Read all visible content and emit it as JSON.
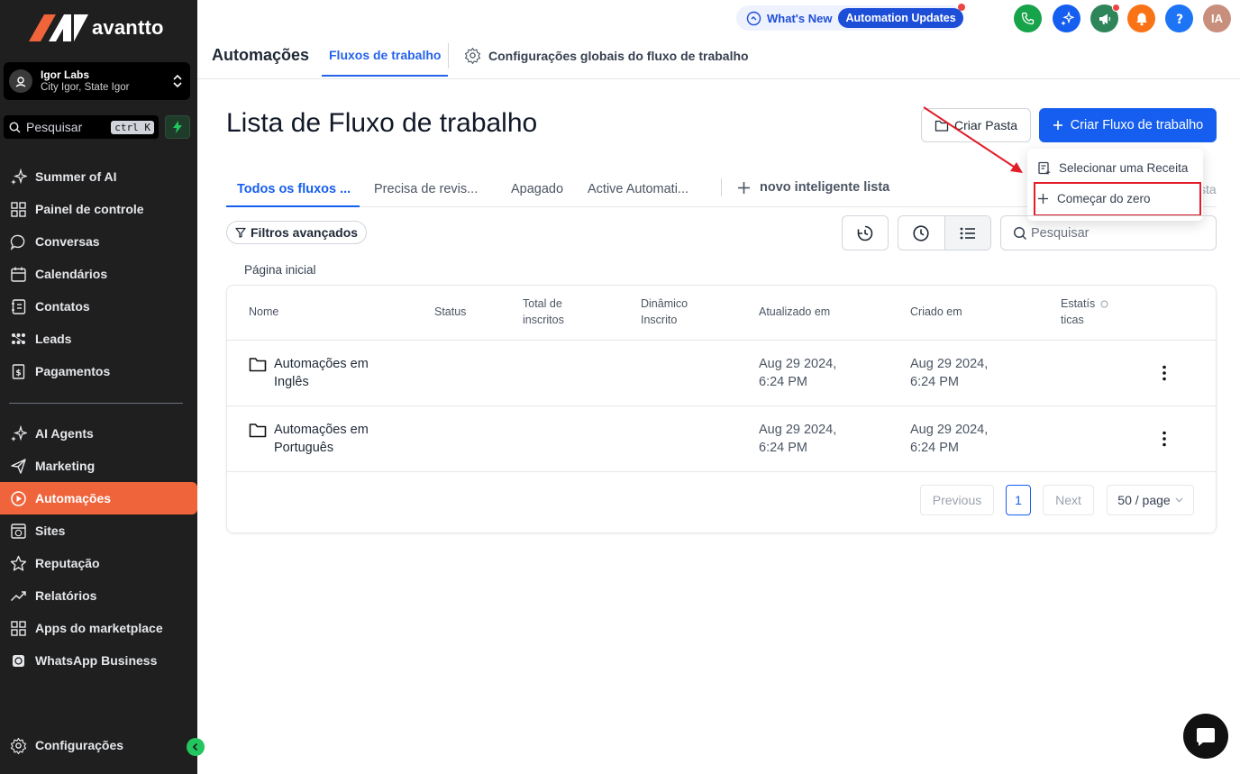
{
  "brand": {
    "name": "avantto"
  },
  "account": {
    "name": "Igor Labs",
    "location": "City Igor, State Igor"
  },
  "sidebar": {
    "search_placeholder": "Pesquisar",
    "search_shortcut": "ctrl K",
    "items": [
      {
        "label": "Summer of AI",
        "icon": "sparkles-icon"
      },
      {
        "label": "Painel de controle",
        "icon": "dashboard-icon"
      },
      {
        "label": "Conversas",
        "icon": "chat-icon"
      },
      {
        "label": "Calendários",
        "icon": "calendar-icon"
      },
      {
        "label": "Contatos",
        "icon": "contacts-icon"
      },
      {
        "label": "Leads",
        "icon": "leads-icon"
      },
      {
        "label": "Pagamentos",
        "icon": "payments-icon"
      },
      {
        "label": "AI Agents",
        "icon": "sparkles-icon"
      },
      {
        "label": "Marketing",
        "icon": "send-icon"
      },
      {
        "label": "Automações",
        "icon": "automation-icon",
        "active": true
      },
      {
        "label": "Sites",
        "icon": "globe-icon"
      },
      {
        "label": "Reputação",
        "icon": "star-icon"
      },
      {
        "label": "Relatórios",
        "icon": "trend-icon"
      },
      {
        "label": "Apps do marketplace",
        "icon": "apps-icon"
      },
      {
        "label": "WhatsApp Business",
        "icon": "whatsapp-icon"
      }
    ],
    "settings_label": "Configurações"
  },
  "header": {
    "whats_new": "What's New",
    "automation_updates": "Automation Updates",
    "avatar_initials": "IA"
  },
  "topnav": {
    "title": "Automações",
    "active_tab": "Fluxos de trabalho",
    "settings_tab": "Configurações globais do fluxo de trabalho"
  },
  "main": {
    "title": "Lista de Fluxo de trabalho",
    "create_folder": "Criar Pasta",
    "create_workflow": "Criar Fluxo de trabalho",
    "dropdown": {
      "recipe": "Selecionar uma Receita",
      "scratch": "Começar do zero"
    },
    "tabs": [
      "Todos os fluxos ...",
      "Precisa de revis...",
      "Apagado",
      "Active Automati..."
    ],
    "new_smart_list": "novo inteligente lista",
    "hidden_tab_text": "sta",
    "filters": "Filtros avançados",
    "search_placeholder": "Pesquisar",
    "breadcrumb": "Página inicial"
  },
  "table": {
    "headers": {
      "name": "Nome",
      "status": "Status",
      "enrolled_1": "Total de",
      "enrolled_2": "inscritos",
      "dynamic_1": "Dinâmico",
      "dynamic_2": "Inscrito",
      "updated": "Atualizado em",
      "created": "Criado em",
      "stats_1": "Estatís",
      "stats_2": "ticas"
    },
    "rows": [
      {
        "name_1": "Automações em",
        "name_2": "Inglês",
        "updated_1": "Aug 29 2024,",
        "updated_2": "6:24 PM",
        "created_1": "Aug 29 2024,",
        "created_2": "6:24 PM"
      },
      {
        "name_1": "Automações em",
        "name_2": "Português",
        "updated_1": "Aug 29 2024,",
        "updated_2": "6:24 PM",
        "created_1": "Aug 29 2024,",
        "created_2": "6:24 PM"
      }
    ],
    "pagination": {
      "previous": "Previous",
      "current": "1",
      "next": "Next",
      "page_size": "50 / page"
    }
  },
  "colors": {
    "accent": "#155eef",
    "brand": "#f0643c",
    "sidebar": "#1f1f1f"
  }
}
